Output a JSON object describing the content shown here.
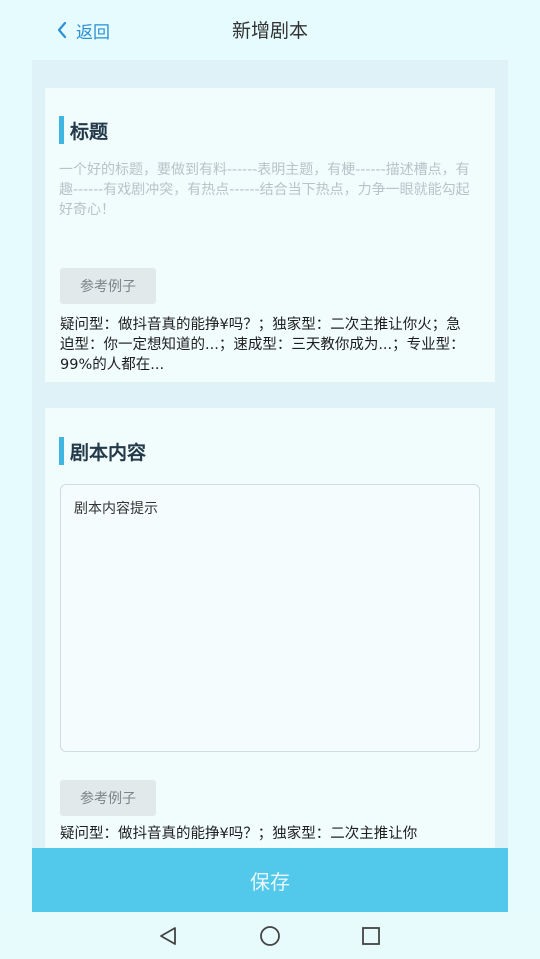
{
  "header": {
    "back_label": "返回",
    "title": "新增剧本"
  },
  "title_section": {
    "heading": "标题",
    "hint": "一个好的标题，要做到有料------表明主题，有梗------描述槽点，有趣------有戏剧冲突，有热点------结合当下热点，力争一眼就能勾起好奇心！",
    "example_button": "参考例子",
    "example_text": "疑问型：做抖音真的能挣¥吗？；独家型：二次主推让你火；急迫型：你一定想知道的...；速成型：三天教你成为...；专业型：99%的人都在..."
  },
  "content_section": {
    "heading": "剧本内容",
    "textarea_placeholder": "剧本内容提示",
    "example_button": "参考例子",
    "example_text": "疑问型：做抖音真的能挣¥吗？；独家型：二次主推让你"
  },
  "save_button": "保存",
  "colors": {
    "accent": "#3fb6e2",
    "save_button": "#52c8ea",
    "link": "#2b8fd6"
  },
  "icons": {
    "back": "chevron-left-icon",
    "nav_back": "triangle-back-icon",
    "nav_home": "circle-home-icon",
    "nav_recent": "square-recent-icon"
  }
}
